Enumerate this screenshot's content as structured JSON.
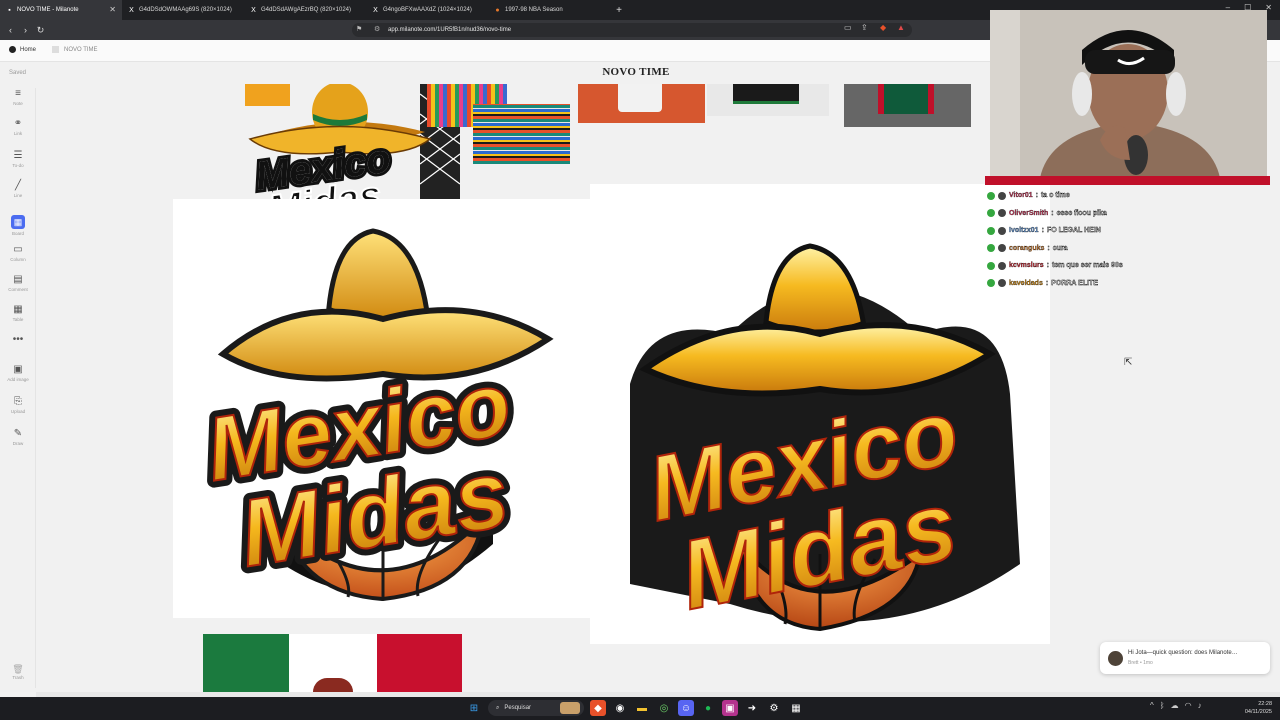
{
  "browser": {
    "tabs": [
      {
        "label": "NOVO TIME - Milanote",
        "icon": "milanote-icon",
        "active": true
      },
      {
        "label": "G4dDSdOWMAAg69S (820×1024)",
        "icon": "x-icon",
        "active": false
      },
      {
        "label": "G4dDSdAWgAEzrBQ (820×1024)",
        "icon": "x-icon",
        "active": false
      },
      {
        "label": "G4ngoBFXwAAXdZ (1024×1024)",
        "icon": "x-icon",
        "active": false
      },
      {
        "label": "1997-98 NBA Season",
        "icon": "basketball-icon",
        "active": false
      }
    ],
    "url": "app.milanote.com/1UR5fB1n/nud36/novo-time"
  },
  "app": {
    "home_label": "Home",
    "board_breadcrumb": "NOVO TIME",
    "saved_label": "Saved",
    "board_title": "NOVO TIME",
    "tools": [
      {
        "label": "Note",
        "icon": "note-icon",
        "glyph": "≡"
      },
      {
        "label": "Link",
        "icon": "link-icon",
        "glyph": "⚭"
      },
      {
        "label": "To-do",
        "icon": "todo-icon",
        "glyph": "☰"
      },
      {
        "label": "Line",
        "icon": "line-icon",
        "glyph": "╱"
      },
      {
        "label": "Board",
        "icon": "board-icon",
        "glyph": "▦"
      },
      {
        "label": "Column",
        "icon": "column-icon",
        "glyph": "▭"
      },
      {
        "label": "Comment",
        "icon": "comment-icon",
        "glyph": "▤"
      },
      {
        "label": "Table",
        "icon": "table-icon",
        "glyph": "▦"
      },
      {
        "label": "",
        "icon": "more-icon",
        "glyph": "•••"
      },
      {
        "label": "Add image",
        "icon": "image-icon",
        "glyph": "▣"
      },
      {
        "label": "Upload",
        "icon": "upload-icon",
        "glyph": "⎘"
      },
      {
        "label": "Draw",
        "icon": "draw-icon",
        "glyph": "✎"
      }
    ],
    "trash_label": "Trash",
    "logo_text_line1": "Mexico",
    "logo_text_line2": "Midas"
  },
  "chat": [
    {
      "user": "Vitor01",
      "user_color": "#e0446a",
      "msg": "ta o time"
    },
    {
      "user": "OliverSmith",
      "user_color": "#e0446a",
      "msg": "esse ficou pika"
    },
    {
      "user": "Ivoltzx01",
      "user_color": "#6fa6e8",
      "msg": "FO LEGAL HEIN"
    },
    {
      "user": "coranguks",
      "user_color": "#e38b3a",
      "msg": "cura"
    },
    {
      "user": "kcvmslurs",
      "user_color": "#e8323f",
      "msg": "tem que ser mais 90s"
    },
    {
      "user": "kaveldads",
      "user_color": "#f0a21e",
      "msg": "PORRA ELITE"
    }
  ],
  "toast": {
    "message": "Hi Jota—quick question: does Milanote…",
    "sub": "Brett • 1mo"
  },
  "taskbar": {
    "search_placeholder": "Pesquisar",
    "time": "22:28",
    "date": "04/11/2025"
  }
}
